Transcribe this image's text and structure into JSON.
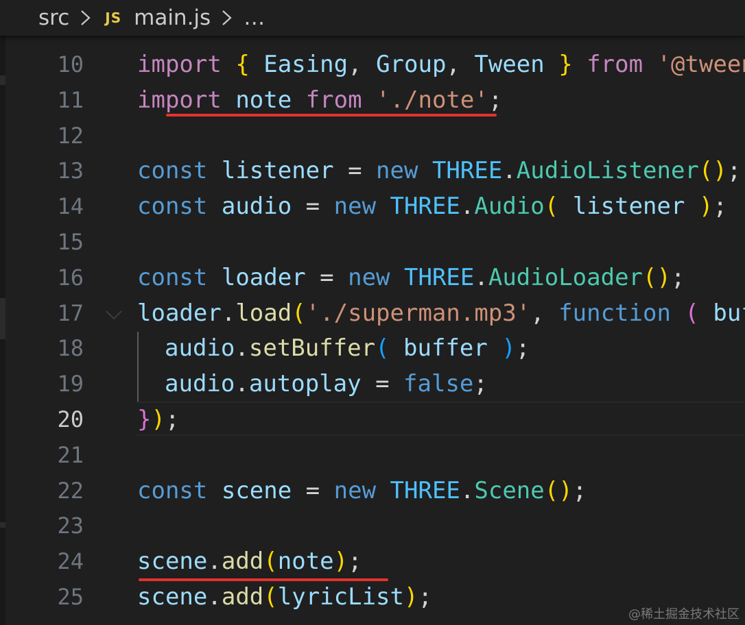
{
  "breadcrumb": {
    "folder": "src",
    "file_icon": "JS",
    "file": "main.js",
    "overflow": "…"
  },
  "lines": [
    {
      "n": "10",
      "tokens": [
        {
          "t": "import",
          "c": "kw"
        },
        {
          "t": " ",
          "c": "pun"
        },
        {
          "t": "{",
          "c": "b1"
        },
        {
          "t": " ",
          "c": "pun"
        },
        {
          "t": "Easing",
          "c": "var"
        },
        {
          "t": ", ",
          "c": "pun"
        },
        {
          "t": "Group",
          "c": "var"
        },
        {
          "t": ", ",
          "c": "pun"
        },
        {
          "t": "Tween",
          "c": "var"
        },
        {
          "t": " ",
          "c": "pun"
        },
        {
          "t": "}",
          "c": "b1"
        },
        {
          "t": " ",
          "c": "pun"
        },
        {
          "t": "from",
          "c": "kw"
        },
        {
          "t": " ",
          "c": "pun"
        },
        {
          "t": "'@tweenjs/tween.js'",
          "c": "st"
        },
        {
          "t": ";",
          "c": "pun"
        }
      ]
    },
    {
      "n": "11",
      "tokens": [
        {
          "t": "import",
          "c": "kw"
        },
        {
          "t": " ",
          "c": "pun"
        },
        {
          "t": "note",
          "c": "var"
        },
        {
          "t": " ",
          "c": "pun"
        },
        {
          "t": "from",
          "c": "kw"
        },
        {
          "t": " ",
          "c": "pun"
        },
        {
          "t": "'./note'",
          "c": "st"
        },
        {
          "t": ";",
          "c": "pun"
        }
      ]
    },
    {
      "n": "12",
      "tokens": []
    },
    {
      "n": "13",
      "tokens": [
        {
          "t": "const",
          "c": "sto"
        },
        {
          "t": " ",
          "c": "pun"
        },
        {
          "t": "listener",
          "c": "var"
        },
        {
          "t": " = ",
          "c": "pun"
        },
        {
          "t": "new",
          "c": "sto"
        },
        {
          "t": " ",
          "c": "pun"
        },
        {
          "t": "THREE",
          "c": "ns"
        },
        {
          "t": ".",
          "c": "pun"
        },
        {
          "t": "AudioListener",
          "c": "cls"
        },
        {
          "t": "()",
          "c": "b1"
        },
        {
          "t": ";",
          "c": "pun"
        }
      ]
    },
    {
      "n": "14",
      "tokens": [
        {
          "t": "const",
          "c": "sto"
        },
        {
          "t": " ",
          "c": "pun"
        },
        {
          "t": "audio",
          "c": "var"
        },
        {
          "t": " = ",
          "c": "pun"
        },
        {
          "t": "new",
          "c": "sto"
        },
        {
          "t": " ",
          "c": "pun"
        },
        {
          "t": "THREE",
          "c": "ns"
        },
        {
          "t": ".",
          "c": "pun"
        },
        {
          "t": "Audio",
          "c": "cls"
        },
        {
          "t": "(",
          "c": "b1"
        },
        {
          "t": " ",
          "c": "pun"
        },
        {
          "t": "listener",
          "c": "var"
        },
        {
          "t": " ",
          "c": "pun"
        },
        {
          "t": ")",
          "c": "b1"
        },
        {
          "t": ";",
          "c": "pun"
        }
      ]
    },
    {
      "n": "15",
      "tokens": []
    },
    {
      "n": "16",
      "tokens": [
        {
          "t": "const",
          "c": "sto"
        },
        {
          "t": " ",
          "c": "pun"
        },
        {
          "t": "loader",
          "c": "var"
        },
        {
          "t": " = ",
          "c": "pun"
        },
        {
          "t": "new",
          "c": "sto"
        },
        {
          "t": " ",
          "c": "pun"
        },
        {
          "t": "THREE",
          "c": "ns"
        },
        {
          "t": ".",
          "c": "pun"
        },
        {
          "t": "AudioLoader",
          "c": "cls"
        },
        {
          "t": "()",
          "c": "b1"
        },
        {
          "t": ";",
          "c": "pun"
        }
      ]
    },
    {
      "n": "17",
      "tokens": [
        {
          "t": "loader",
          "c": "var"
        },
        {
          "t": ".",
          "c": "pun"
        },
        {
          "t": "load",
          "c": "fn"
        },
        {
          "t": "(",
          "c": "b1"
        },
        {
          "t": "'./superman.mp3'",
          "c": "st"
        },
        {
          "t": ", ",
          "c": "pun"
        },
        {
          "t": "function",
          "c": "sto"
        },
        {
          "t": " ",
          "c": "pun"
        },
        {
          "t": "(",
          "c": "b2"
        },
        {
          "t": " ",
          "c": "pun"
        },
        {
          "t": "buffer",
          "c": "var"
        }
      ]
    },
    {
      "n": "18",
      "indent": true,
      "tokens": [
        {
          "t": "audio",
          "c": "var"
        },
        {
          "t": ".",
          "c": "pun"
        },
        {
          "t": "setBuffer",
          "c": "fn"
        },
        {
          "t": "(",
          "c": "b3"
        },
        {
          "t": " ",
          "c": "pun"
        },
        {
          "t": "buffer",
          "c": "var"
        },
        {
          "t": " ",
          "c": "pun"
        },
        {
          "t": ")",
          "c": "b3"
        },
        {
          "t": ";",
          "c": "pun"
        }
      ]
    },
    {
      "n": "19",
      "indent": true,
      "tokens": [
        {
          "t": "audio",
          "c": "var"
        },
        {
          "t": ".",
          "c": "pun"
        },
        {
          "t": "autoplay",
          "c": "var"
        },
        {
          "t": " = ",
          "c": "pun"
        },
        {
          "t": "false",
          "c": "sto"
        },
        {
          "t": ";",
          "c": "pun"
        }
      ]
    },
    {
      "n": "20",
      "active": true,
      "tokens": [
        {
          "t": "}",
          "c": "b2"
        },
        {
          "t": ")",
          "c": "b1"
        },
        {
          "t": ";",
          "c": "pun"
        }
      ]
    },
    {
      "n": "21",
      "tokens": []
    },
    {
      "n": "22",
      "tokens": [
        {
          "t": "const",
          "c": "sto"
        },
        {
          "t": " ",
          "c": "pun"
        },
        {
          "t": "scene",
          "c": "var"
        },
        {
          "t": " = ",
          "c": "pun"
        },
        {
          "t": "new",
          "c": "sto"
        },
        {
          "t": " ",
          "c": "pun"
        },
        {
          "t": "THREE",
          "c": "ns"
        },
        {
          "t": ".",
          "c": "pun"
        },
        {
          "t": "Scene",
          "c": "cls"
        },
        {
          "t": "()",
          "c": "b1"
        },
        {
          "t": ";",
          "c": "pun"
        }
      ]
    },
    {
      "n": "23",
      "tokens": []
    },
    {
      "n": "24",
      "tokens": [
        {
          "t": "scene",
          "c": "var"
        },
        {
          "t": ".",
          "c": "pun"
        },
        {
          "t": "add",
          "c": "fn"
        },
        {
          "t": "(",
          "c": "b1"
        },
        {
          "t": "note",
          "c": "var"
        },
        {
          "t": ")",
          "c": "b1"
        },
        {
          "t": ";",
          "c": "pun"
        }
      ]
    },
    {
      "n": "25",
      "tokens": [
        {
          "t": "scene",
          "c": "var"
        },
        {
          "t": ".",
          "c": "pun"
        },
        {
          "t": "add",
          "c": "fn"
        },
        {
          "t": "(",
          "c": "b1"
        },
        {
          "t": "lyricList",
          "c": "var"
        },
        {
          "t": ")",
          "c": "b1"
        },
        {
          "t": ";",
          "c": "pun"
        }
      ]
    }
  ],
  "watermark": "@稀土掘金技术社区",
  "colors": {
    "background": "#1f1f1f",
    "underline": "#e5322d",
    "keyword": "#c586c0",
    "string": "#ce9178"
  }
}
